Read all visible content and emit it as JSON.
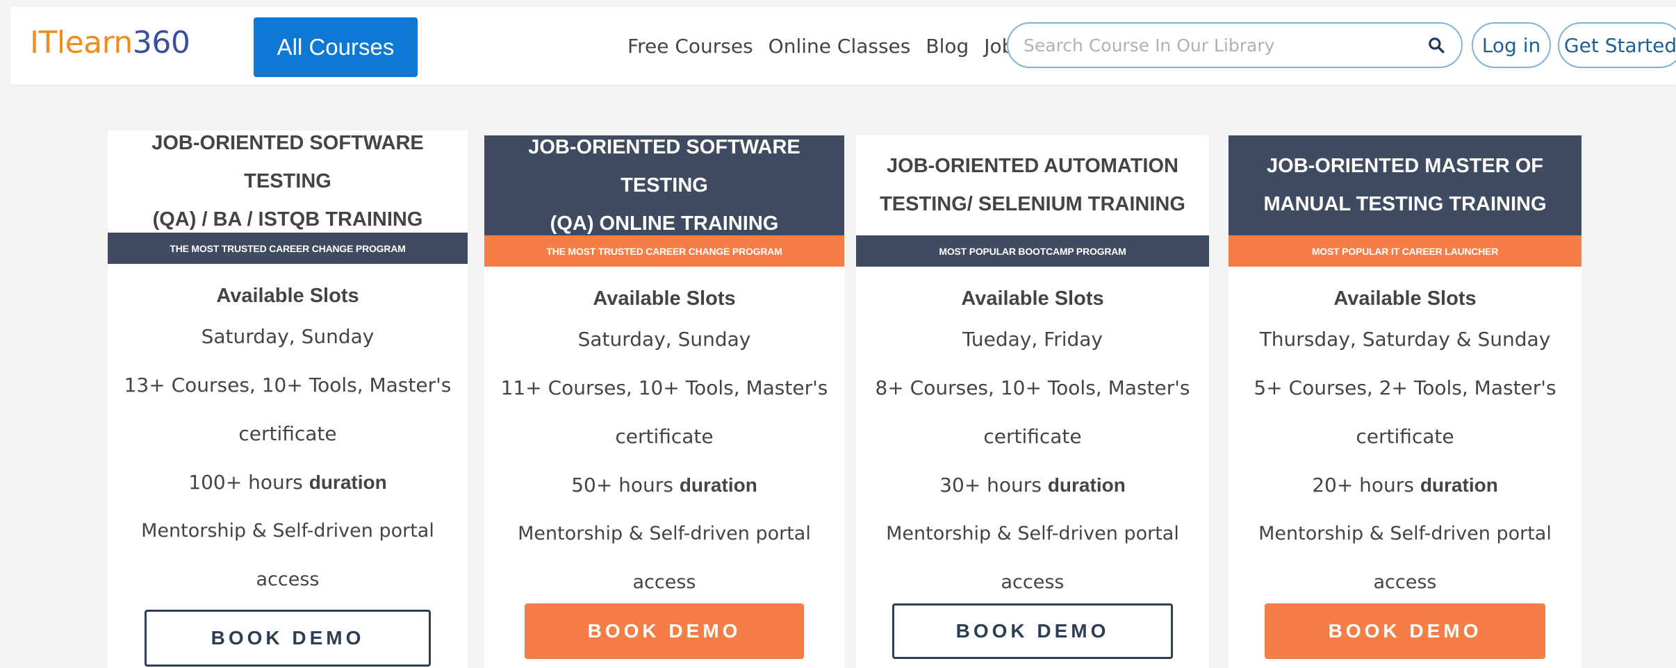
{
  "header": {
    "logo_part1": "ITlearn",
    "logo_part2": "360",
    "all_courses_label": "All Courses",
    "nav": [
      "Free Courses",
      "Online Classes",
      "Blog",
      "Jobs"
    ],
    "search_placeholder": "Search Course In Our Library",
    "login_label": "Log in",
    "get_started_label": "Get Started"
  },
  "colors": {
    "brand_orange": "#f08c1b",
    "brand_blue": "#3a4fa0",
    "button_blue": "#0e78d5",
    "card_dark": "#3f4b61",
    "accent_orange": "#f47e46"
  },
  "cards": [
    {
      "title_line1": "JOB-ORIENTED SOFTWARE TESTING",
      "title_line2": "(QA) / BA / ISTQB TRAINING",
      "subtitle": "THE MOST TRUSTED CAREER CHANGE PROGRAM",
      "slots_title": "Available Slots",
      "days": "Saturday, Sunday",
      "courses": "13+ Courses, 10+ Tools, Master's",
      "certificate": "certificate",
      "hours": "100+ hours",
      "duration": "duration",
      "access": "Mentorship & Self-driven portal access",
      "button": "BOOK DEMO"
    },
    {
      "title_line1": "JOB-ORIENTED SOFTWARE TESTING",
      "title_line2": "(QA) ONLINE TRAINING",
      "subtitle": "THE MOST TRUSTED CAREER CHANGE PROGRAM",
      "slots_title": "Available Slots",
      "days": "Saturday, Sunday",
      "courses": "11+ Courses, 10+ Tools, Master's",
      "certificate": "certificate",
      "hours": "50+ hours",
      "duration": "duration",
      "access": "Mentorship & Self-driven portal access",
      "button": "BOOK DEMO"
    },
    {
      "title_line1": "JOB-ORIENTED AUTOMATION",
      "title_line2": "TESTING/ SELENIUM TRAINING",
      "subtitle": "MOST POPULAR BOOTCAMP PROGRAM",
      "slots_title": "Available Slots",
      "days": "Tueday, Friday",
      "courses": "8+ Courses, 10+ Tools, Master's",
      "certificate": "certificate",
      "hours": "30+ hours",
      "duration": "duration",
      "access": "Mentorship & Self-driven portal access",
      "button": "BOOK DEMO"
    },
    {
      "title_line1": "JOB-ORIENTED MASTER OF",
      "title_line2": "MANUAL TESTING TRAINING",
      "subtitle": "MOST POPULAR IT CAREER LAUNCHER",
      "slots_title": "Available Slots",
      "days": "Thursday, Saturday & Sunday",
      "courses": "5+ Courses, 2+ Tools, Master's",
      "certificate": "certificate",
      "hours": "20+ hours",
      "duration": "duration",
      "access": "Mentorship & Self-driven portal access",
      "button": "BOOK DEMO"
    }
  ]
}
